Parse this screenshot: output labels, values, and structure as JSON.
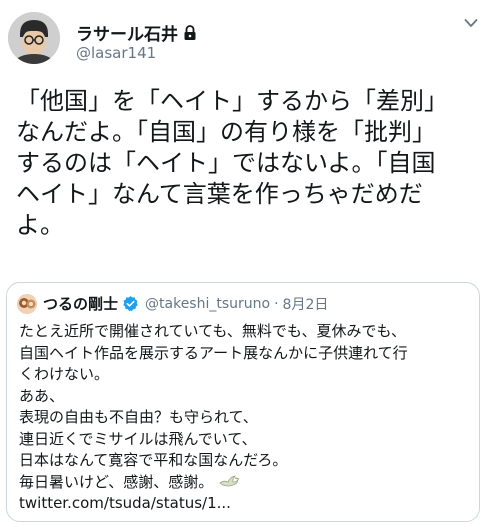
{
  "author": {
    "display_name": "ラサール石井",
    "handle": "@lasar141",
    "protected_icon": "lock-icon"
  },
  "tweet": {
    "text": "「他国」を「ヘイト」するから「差別」\nなんだよ。「自国」の有り様を「批判」\nするのは「ヘイト」ではないよ。「自国\nヘイト」なんて言葉を作っちゃだめだ\nよ。"
  },
  "quoted": {
    "display_name": "つるの剛士",
    "verified_icon": "verified-badge-icon",
    "handle": "@takeshi_tsuruno",
    "separator": "·",
    "date": "8月2日",
    "text": "たとえ近所で開催されていても、無料でも、夏休みでも、\n自国ヘイト作品を展示するアート展なんかに子供連れて行\nくわけない。\nああ、\n表現の自由も不自由？も守られて、\n連日近くでミサイルは飛んでいて、\n日本はなんて寛容で平和な国なんだろ。\n毎日暑いけど、感謝、感謝。",
    "link": "twitter.com/tsuda/status/1..."
  },
  "colors": {
    "text": "#14171a",
    "secondary": "#657786",
    "border": "#ccd6dd",
    "verified": "#1da1f2"
  }
}
